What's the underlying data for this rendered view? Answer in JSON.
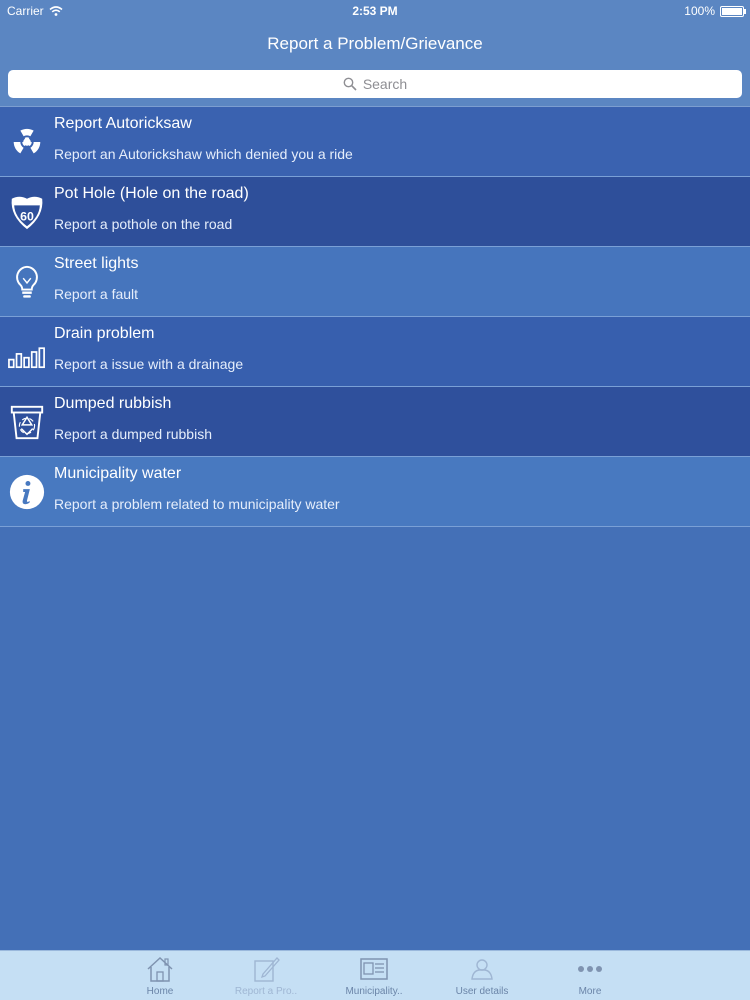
{
  "status": {
    "carrier": "Carrier",
    "time": "2:53 PM",
    "battery": "100%",
    "battery_level": 1.0
  },
  "navbar": {
    "title": "Report a Problem/Grievance"
  },
  "search": {
    "placeholder": "Search"
  },
  "items": [
    {
      "title": "Report Autoricksaw",
      "subtitle": "Report an Autorickshaw which denied you a ride",
      "icon": "radiation-icon",
      "bg": "#3a62b0"
    },
    {
      "title": "Pot Hole (Hole on the road)",
      "subtitle": "Report a pothole on the road",
      "icon": "highway-shield-icon",
      "bg": "#2e4f9a"
    },
    {
      "title": "Street lights",
      "subtitle": "Report a fault",
      "icon": "lightbulb-icon",
      "bg": "#4675bd"
    },
    {
      "title": "Drain problem",
      "subtitle": "Report a issue with a drainage",
      "icon": "signal-bars-icon",
      "bg": "#375fae"
    },
    {
      "title": "Dumped rubbish",
      "subtitle": "Report a dumped rubbish",
      "icon": "recycle-bin-icon",
      "bg": "#2f509c"
    },
    {
      "title": "Municipality water",
      "subtitle": "Report a problem related to municipality water",
      "icon": "info-icon",
      "bg": "#4879c0"
    }
  ],
  "tabs": [
    {
      "label": "Home",
      "icon": "home-icon"
    },
    {
      "label": "Report a Pro..",
      "icon": "edit-icon"
    },
    {
      "label": "Municipality..",
      "icon": "id-card-icon"
    },
    {
      "label": "User details",
      "icon": "user-icon"
    },
    {
      "label": "More",
      "icon": "more-icon"
    }
  ]
}
